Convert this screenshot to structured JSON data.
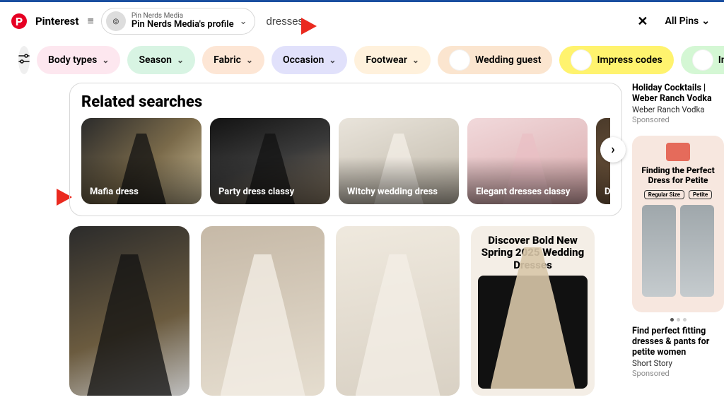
{
  "header": {
    "brand": "Pinterest",
    "profile_sub": "Pin Nerds Media",
    "profile_main": "Pin Nerds Media's profile",
    "search_value": "dresses",
    "all_pins": "All Pins"
  },
  "chips": [
    {
      "label": "Body types",
      "bg": "#fde7ef",
      "dd": true
    },
    {
      "label": "Season",
      "bg": "#d8f4e3",
      "dd": true
    },
    {
      "label": "Fabric",
      "bg": "#fde6d5",
      "dd": true
    },
    {
      "label": "Occasion",
      "bg": "#e1e1fb",
      "dd": true
    },
    {
      "label": "Footwear",
      "bg": "#fff1dc",
      "dd": true
    },
    {
      "label": "Wedding guest",
      "bg": "#fbe5cf",
      "img": true
    },
    {
      "label": "Impress codes",
      "bg": "#fff36e",
      "img": true
    },
    {
      "label": "Impress",
      "bg": "#d4f7d4",
      "img": true
    }
  ],
  "related": {
    "title": "Related searches",
    "items": [
      "Mafia dress",
      "Party dress classy",
      "Witchy wedding dress",
      "Elegant dresses classy",
      "Dress"
    ]
  },
  "pins": {
    "promo_headline": "Discover Bold New Spring 2025 Wedding Dresses"
  },
  "rail": {
    "a": {
      "t1": "Holiday Cocktails | Weber Ranch Vodka",
      "t2": "Weber Ranch Vodka",
      "t3": "Sponsored"
    },
    "hero": {
      "h1": "Finding the Perfect Dress for Petite",
      "size_a": "Regular Size",
      "size_b": "Petite"
    },
    "b": {
      "t1": "Find perfect fitting dresses & pants for petite women",
      "t2": "Short Story",
      "t3": "Sponsored"
    }
  }
}
